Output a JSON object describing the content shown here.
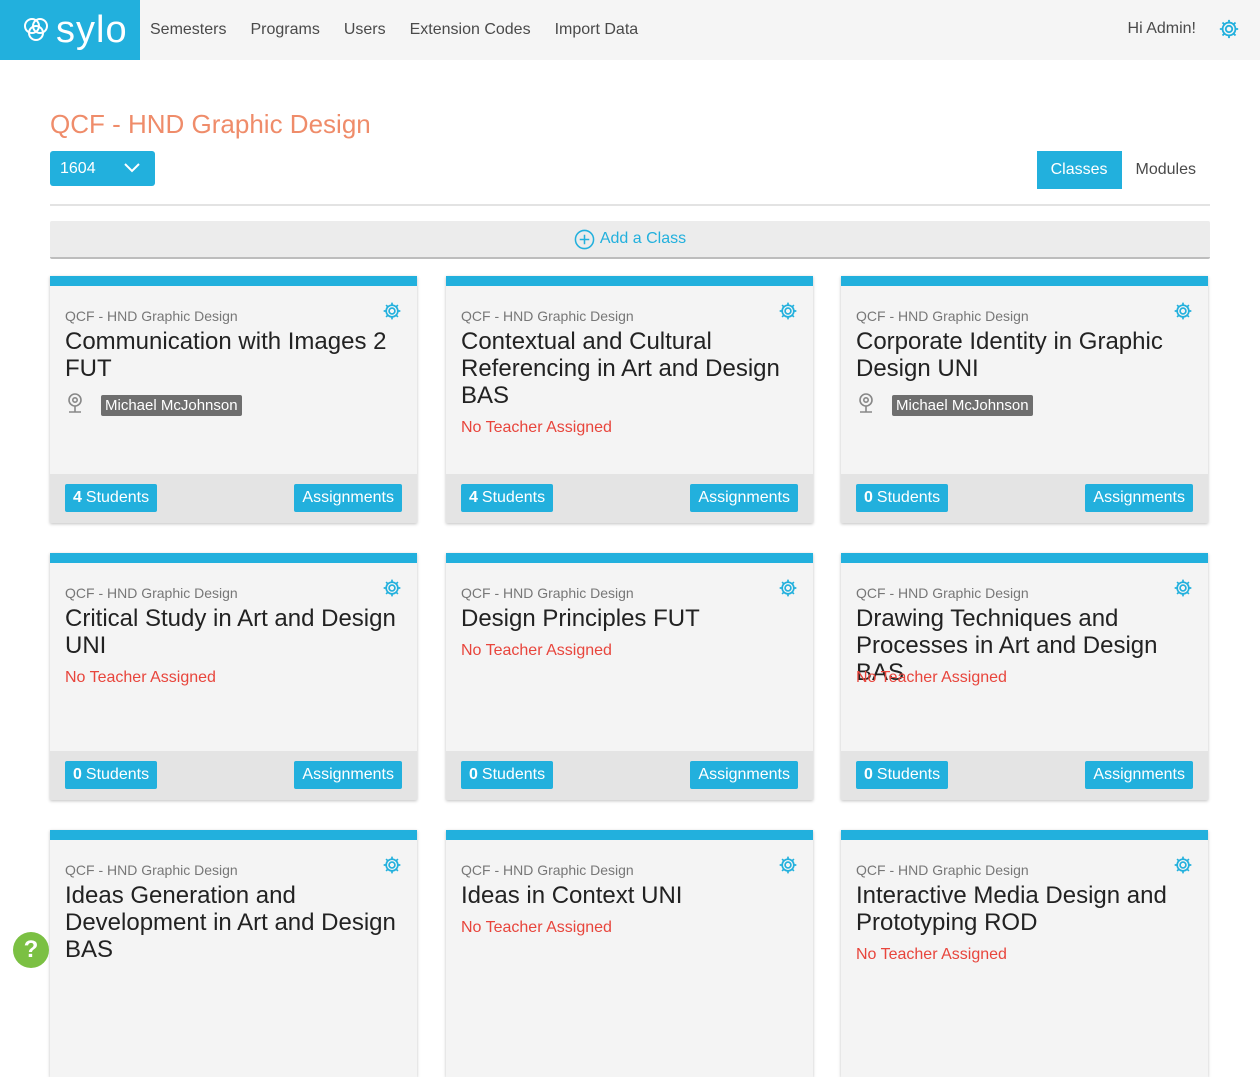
{
  "brand": {
    "name": "sylo"
  },
  "nav": {
    "items": [
      "Semesters",
      "Programs",
      "Users",
      "Extension Codes",
      "Import Data"
    ]
  },
  "header": {
    "greeting": "Hi Admin!"
  },
  "page": {
    "title": "QCF - HND Graphic Design",
    "semester_selected": "1604",
    "view_tabs": [
      {
        "label": "Classes",
        "active": true
      },
      {
        "label": "Modules",
        "active": false
      }
    ],
    "add_class_label": "Add a Class"
  },
  "cards": [
    {
      "program": "QCF - HND Graphic Design",
      "title": "Communication with Images 2 FUT",
      "teacher": "Michael McJohnson",
      "no_teacher": "",
      "students": "4",
      "students_label": "Students",
      "assignments_label": "Assignments"
    },
    {
      "program": "QCF - HND Graphic Design",
      "title": "Contextual and Cultural Referencing in Art and Design BAS",
      "teacher": "",
      "no_teacher": "No Teacher Assigned",
      "students": "4",
      "students_label": "Students",
      "assignments_label": "Assignments"
    },
    {
      "program": "QCF - HND Graphic Design",
      "title": "Corporate Identity in Graphic Design UNI",
      "teacher": "Michael McJohnson",
      "no_teacher": "",
      "students": "0",
      "students_label": "Students",
      "assignments_label": "Assignments"
    },
    {
      "program": "QCF - HND Graphic Design",
      "title": "Critical Study in Art and Design UNI",
      "teacher": "",
      "no_teacher": "No Teacher Assigned",
      "students": "0",
      "students_label": "Students",
      "assignments_label": "Assignments"
    },
    {
      "program": "QCF - HND Graphic Design",
      "title": "Design Principles FUT",
      "teacher": "",
      "no_teacher": "No Teacher Assigned",
      "students": "0",
      "students_label": "Students",
      "assignments_label": "Assignments"
    },
    {
      "program": "QCF - HND Graphic Design",
      "title": "Drawing Techniques and Processes in Art and Design BAS",
      "teacher": "",
      "no_teacher": "No Teacher Assigned",
      "students": "0",
      "students_label": "Students",
      "assignments_label": "Assignments"
    },
    {
      "program": "QCF - HND Graphic Design",
      "title": "Ideas Generation and Development in Art and Design BAS",
      "teacher": "",
      "no_teacher": "",
      "students": "",
      "students_label": "",
      "assignments_label": ""
    },
    {
      "program": "QCF - HND Graphic Design",
      "title": "Ideas in Context UNI",
      "teacher": "",
      "no_teacher": "No Teacher Assigned",
      "students": "",
      "students_label": "",
      "assignments_label": ""
    },
    {
      "program": "QCF - HND Graphic Design",
      "title": "Interactive Media Design and Prototyping ROD",
      "teacher": "",
      "no_teacher": "No Teacher Assigned",
      "students": "",
      "students_label": "",
      "assignments_label": ""
    }
  ],
  "help": {
    "label": "?"
  },
  "colors": {
    "accent": "#22b0dd",
    "title": "#ef8c6a",
    "warning": "#e8453c",
    "help": "#7bc043"
  }
}
